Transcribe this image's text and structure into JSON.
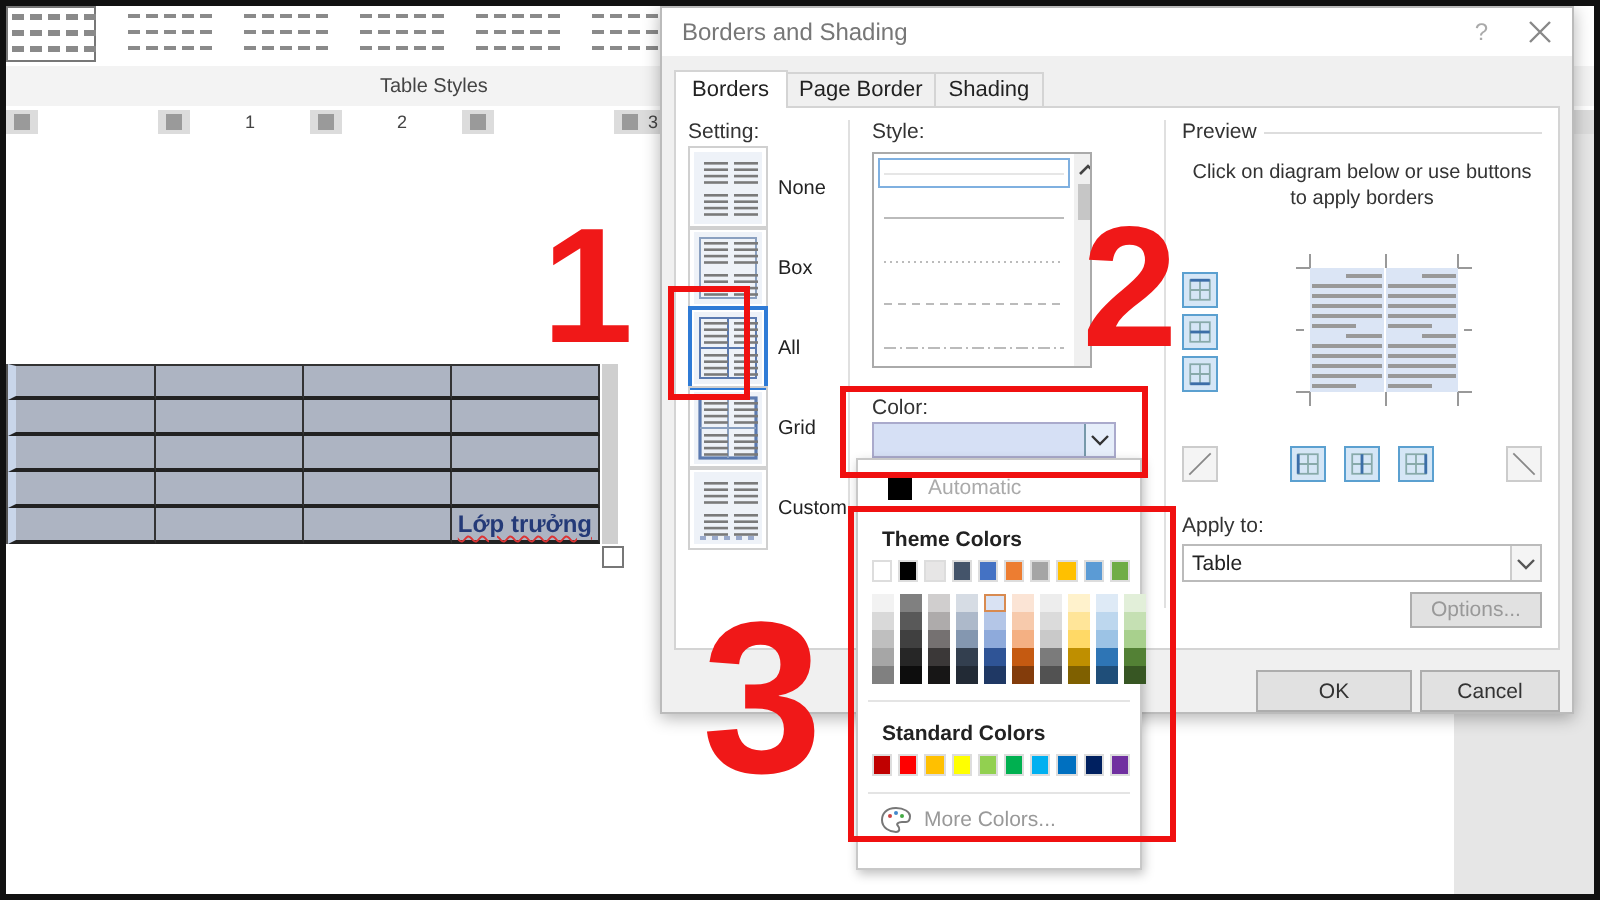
{
  "document": {
    "ribbon_group_label": "Table Styles",
    "ruler": [
      "1",
      "2",
      "3"
    ],
    "table": {
      "rows": [
        [
          "",
          "",
          "",
          ""
        ],
        [
          "",
          "",
          "",
          ""
        ],
        [
          "",
          "",
          "",
          ""
        ],
        [
          "",
          "",
          "",
          ""
        ],
        [
          "",
          "",
          "",
          "Lớp trưởng"
        ]
      ]
    }
  },
  "dialog": {
    "title": "Borders and Shading",
    "help": "?",
    "tabs": [
      {
        "label": "Borders",
        "selected": true
      },
      {
        "label": "Page Border",
        "selected": false
      },
      {
        "label": "Shading",
        "selected": false
      }
    ],
    "setting": {
      "label": "Setting:",
      "options": [
        {
          "kind": "none",
          "label": "None",
          "selected": false
        },
        {
          "kind": "box",
          "label": "Box",
          "selected": false
        },
        {
          "kind": "all",
          "label": "All",
          "selected": true
        },
        {
          "kind": "grid",
          "label": "Grid",
          "selected": false
        },
        {
          "kind": "custom",
          "label": "Custom",
          "selected": false
        }
      ]
    },
    "style": {
      "label": "Style:",
      "options": [
        {
          "kind": "none",
          "selected": true
        },
        {
          "kind": "solid",
          "selected": false
        },
        {
          "kind": "dotted",
          "selected": false
        },
        {
          "kind": "dashed",
          "selected": false
        },
        {
          "kind": "dash-dot",
          "selected": false
        }
      ]
    },
    "color": {
      "label": "Color:"
    },
    "preview": {
      "label": "Preview",
      "hint": "Click on diagram below or use buttons to apply borders",
      "side_buttons": [
        {
          "kind": "top",
          "on": true
        },
        {
          "kind": "middle",
          "on": true
        },
        {
          "kind": "bottom",
          "on": true
        }
      ],
      "bottom_buttons": [
        {
          "kind": "diagonal-up",
          "on": false
        },
        {
          "kind": "left",
          "on": true
        },
        {
          "kind": "center",
          "on": true
        },
        {
          "kind": "right",
          "on": true
        },
        {
          "kind": "diagonal-down",
          "on": false
        }
      ]
    },
    "apply_to": {
      "label": "Apply to:",
      "value": "Table"
    },
    "options_button": "Options...",
    "buttons": [
      "OK",
      "Cancel"
    ]
  },
  "color_menu": {
    "automatic": "Automatic",
    "theme_title": "Theme Colors",
    "theme_colors": [
      {
        "color": "#ffffff"
      },
      {
        "color": "#000000"
      },
      {
        "color": "#e7e6e6"
      },
      {
        "color": "#44546a"
      },
      {
        "color": "#4472c4"
      },
      {
        "color": "#ed7d31"
      },
      {
        "color": "#a5a5a5"
      },
      {
        "color": "#ffc000"
      },
      {
        "color": "#5b9bd5"
      },
      {
        "color": "#70ad47"
      }
    ],
    "shades": [
      [
        {
          "color": "#f2f2f2",
          "selected": false
        },
        {
          "color": "#d9d9d9",
          "selected": false
        },
        {
          "color": "#bfbfbf",
          "selected": false
        },
        {
          "color": "#a6a6a6",
          "selected": false
        },
        {
          "color": "#808080",
          "selected": false
        }
      ],
      [
        {
          "color": "#808080",
          "selected": false
        },
        {
          "color": "#595959",
          "selected": false
        },
        {
          "color": "#404040",
          "selected": false
        },
        {
          "color": "#262626",
          "selected": false
        },
        {
          "color": "#0d0d0d",
          "selected": false
        }
      ],
      [
        {
          "color": "#d0cece",
          "selected": false
        },
        {
          "color": "#aeabab",
          "selected": false
        },
        {
          "color": "#757171",
          "selected": false
        },
        {
          "color": "#3b3838",
          "selected": false
        },
        {
          "color": "#171616",
          "selected": false
        }
      ],
      [
        {
          "color": "#d6dce4",
          "selected": false
        },
        {
          "color": "#adb9ca",
          "selected": false
        },
        {
          "color": "#8497b0",
          "selected": false
        },
        {
          "color": "#333f4f",
          "selected": false
        },
        {
          "color": "#222a35",
          "selected": false
        }
      ],
      [
        {
          "color": "#d9e2f3",
          "selected": true
        },
        {
          "color": "#b4c6e7",
          "selected": false
        },
        {
          "color": "#8eaadb",
          "selected": false
        },
        {
          "color": "#2f5496",
          "selected": false
        },
        {
          "color": "#1f3864",
          "selected": false
        }
      ],
      [
        {
          "color": "#fbe4d5",
          "selected": false
        },
        {
          "color": "#f7caac",
          "selected": false
        },
        {
          "color": "#f4b083",
          "selected": false
        },
        {
          "color": "#c55a11",
          "selected": false
        },
        {
          "color": "#833c0b",
          "selected": false
        }
      ],
      [
        {
          "color": "#ededed",
          "selected": false
        },
        {
          "color": "#dbdbdb",
          "selected": false
        },
        {
          "color": "#c9c9c9",
          "selected": false
        },
        {
          "color": "#7b7b7b",
          "selected": false
        },
        {
          "color": "#525252",
          "selected": false
        }
      ],
      [
        {
          "color": "#fff2cc",
          "selected": false
        },
        {
          "color": "#ffe599",
          "selected": false
        },
        {
          "color": "#ffd966",
          "selected": false
        },
        {
          "color": "#bf8f00",
          "selected": false
        },
        {
          "color": "#7f6000",
          "selected": false
        }
      ],
      [
        {
          "color": "#deeaf6",
          "selected": false
        },
        {
          "color": "#bdd7ee",
          "selected": false
        },
        {
          "color": "#9cc3e5",
          "selected": false
        },
        {
          "color": "#2e75b5",
          "selected": false
        },
        {
          "color": "#1f4e79",
          "selected": false
        }
      ],
      [
        {
          "color": "#e2efd9",
          "selected": false
        },
        {
          "color": "#c5e0b3",
          "selected": false
        },
        {
          "color": "#a8d08d",
          "selected": false
        },
        {
          "color": "#538135",
          "selected": false
        },
        {
          "color": "#375623",
          "selected": false
        }
      ]
    ],
    "standard_title": "Standard Colors",
    "standard_colors": [
      {
        "color": "#c00000"
      },
      {
        "color": "#ff0000"
      },
      {
        "color": "#ffc000"
      },
      {
        "color": "#ffff00"
      },
      {
        "color": "#92d050"
      },
      {
        "color": "#00b050"
      },
      {
        "color": "#00b0f0"
      },
      {
        "color": "#0070c0"
      },
      {
        "color": "#002060"
      },
      {
        "color": "#7030a0"
      }
    ],
    "more": "More Colors..."
  },
  "annotations": [
    {
      "text": "1"
    },
    {
      "text": "2"
    },
    {
      "text": "3"
    }
  ]
}
